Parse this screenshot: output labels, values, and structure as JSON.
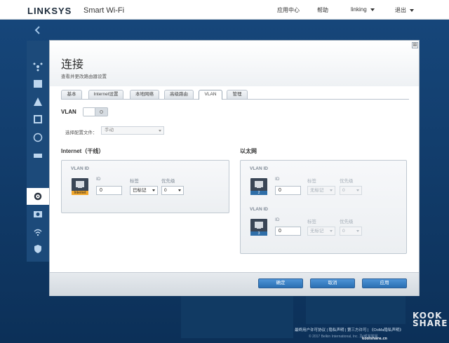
{
  "header": {
    "brand": "LINKSYS",
    "product": "Smart Wi-Fi",
    "nav": {
      "app_center": "应用中心",
      "help": "帮助",
      "user": "linking",
      "logout": "退出"
    }
  },
  "modal": {
    "title": "连接",
    "subtitle": "查看并更改路由器设置",
    "close_glyph": "⊠",
    "tabs": [
      "基本",
      "Internet设置",
      "本地网络",
      "高级路由",
      "VLAN",
      "管理"
    ],
    "active_tab": "VLAN",
    "vlan_label": "VLAN",
    "vlan_enabled": true,
    "profile": {
      "label": "选择配置文件：",
      "value": "手动"
    },
    "internet": {
      "title": "Internet（干线）",
      "vlan_id_label": "VLAN ID",
      "port_label": "Internet",
      "id_label": "ID",
      "id_value": "0",
      "tag_label": "标签",
      "tag_value": "已标记",
      "priority_label": "优先级",
      "priority_value": "0"
    },
    "ethernet": {
      "title": "以太网",
      "ports": [
        {
          "vlan_id_label": "VLAN ID",
          "port_num": "2",
          "id_label": "ID",
          "id_value": "0",
          "tag_label": "标签",
          "tag_value": "无标记",
          "priority_label": "优先级",
          "priority_value": "0"
        },
        {
          "vlan_id_label": "VLAN ID",
          "port_num": "3",
          "id_label": "ID",
          "id_value": "0",
          "tag_label": "标签",
          "tag_value": "无标记",
          "priority_label": "优先级",
          "priority_value": "0"
        }
      ]
    },
    "buttons": {
      "ok": "确定",
      "cancel": "取消",
      "apply": "应用"
    }
  },
  "footer": {
    "links": "最终用户许可协议 | 隐私声明 | 第三方许可 | 《OoMa隐私声明》",
    "copyright": "© 2017 Belkin International, Inc. 及/或其附属"
  },
  "watermark": {
    "line1": "KOOK",
    "line2": "SHARE",
    "site": "koolshare.cn"
  },
  "colors": {
    "primary_button": "#2a6fb3",
    "internet_port": "#f0a62a",
    "ethernet_port": "#2f6ea8",
    "background": "#0f3a66"
  }
}
